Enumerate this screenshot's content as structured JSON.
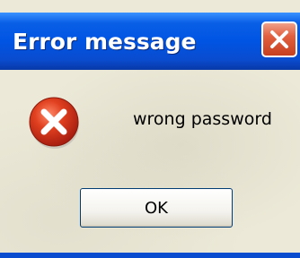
{
  "dialog": {
    "title": "Error message",
    "message": "wrong password",
    "ok_label": "OK"
  },
  "icons": {
    "close": "close-icon",
    "error": "error-icon"
  },
  "colors": {
    "titlebar": "#0054e3",
    "close_button": "#d5542f",
    "error_icon": "#d8321e",
    "dialog_background": "#ece9d8"
  }
}
